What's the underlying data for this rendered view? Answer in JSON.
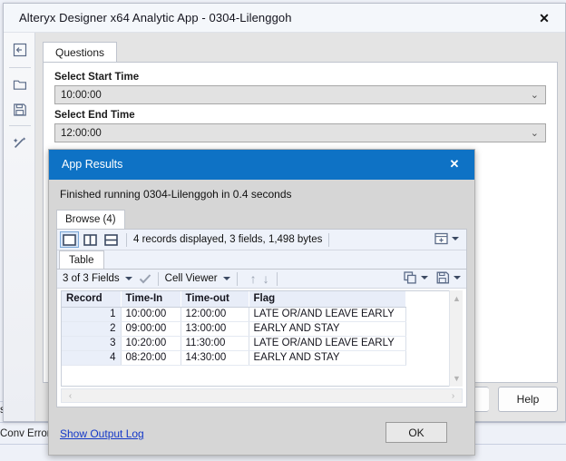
{
  "app_window": {
    "title": "Alteryx Designer x64 Analytic App  - 0304-Lilenggoh",
    "close_label": "✕",
    "tab_label": "Questions",
    "rail_icons": [
      "back-arrow-icon",
      "folder-icon",
      "save-icon",
      "magic-wand-icon"
    ],
    "fields": [
      {
        "label": "Select Start Time",
        "value": "10:00:00",
        "chevron": "⌄"
      },
      {
        "label": "Select End Time",
        "value": "12:00:00",
        "chevron": "⌄"
      }
    ],
    "buttons": {
      "help": "Help"
    }
  },
  "background": {
    "left_labels": [
      "s",
      "Conv Error"
    ]
  },
  "results_dialog": {
    "title": "App Results",
    "close_label": "✕",
    "status_text": "Finished running 0304-Lilenggoh in 0.4 seconds",
    "browse_tab": "Browse (4)",
    "toolbar": {
      "layout_buttons": [
        "single-pane-icon",
        "vertical-split-icon",
        "horizontal-split-icon"
      ],
      "records_info": "4 records displayed, 3 fields, 1,498 bytes",
      "add_grid_icon": "add-table-icon"
    },
    "table_tab": "Table",
    "field_toolbar": {
      "fields_label": "3 of 3 Fields",
      "check_icon": "checkmark-icon",
      "cell_viewer_label": "Cell Viewer",
      "up_arrow": "↑",
      "down_arrow": "↓",
      "copy_icon": "copy-icon",
      "save_icon": "save-icon"
    },
    "grid": {
      "columns": [
        "Record",
        "Time-In",
        "Time-out",
        "Flag"
      ],
      "rows": [
        {
          "record": "1",
          "time_in": "10:00:00",
          "time_out": "12:00:00",
          "flag": "LATE OR/AND LEAVE EARLY"
        },
        {
          "record": "2",
          "time_in": "09:00:00",
          "time_out": "13:00:00",
          "flag": "EARLY AND STAY"
        },
        {
          "record": "3",
          "time_in": "10:20:00",
          "time_out": "11:30:00",
          "flag": "LATE OR/AND LEAVE EARLY"
        },
        {
          "record": "4",
          "time_in": "08:20:00",
          "time_out": "14:30:00",
          "flag": "EARLY AND STAY"
        }
      ]
    },
    "scroll": {
      "up": "▲",
      "down": "▼",
      "left": "‹",
      "right": "›"
    },
    "footer": {
      "show_output_log": "Show Output Log",
      "ok": "OK"
    }
  },
  "colors": {
    "dialog_titlebar": "#0e72c5",
    "link": "#1438c8",
    "desktop": "#eef1f8"
  }
}
